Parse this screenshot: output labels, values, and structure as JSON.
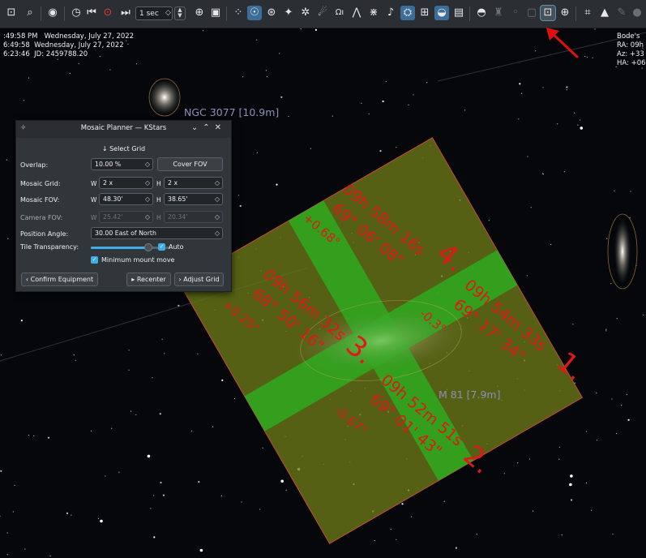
{
  "toolbar": {
    "time_step": "1 sec",
    "icons": [
      "zoom-fit-icon",
      "search-icon",
      "globe-icon",
      "clock-icon",
      "step-backward-icon",
      "pause-clock-icon",
      "step-forward-icon",
      "rate-select",
      "spin-icon",
      "equatorial-icon",
      "image-overlay-icon",
      "stars-icon",
      "deep-sky-icon",
      "galaxy-icon",
      "star-icon",
      "nebula-icon",
      "comet-icon",
      "constellation-names-icon",
      "constellation-lines-icon",
      "constellation-art-icon",
      "milky-way-icon",
      "grid-icon",
      "boundaries-icon",
      "horizon-icon",
      "satellite-icon",
      "supernova-icon",
      "hips-icon",
      "telescope-icon",
      "flag-icon",
      "eyepiece-icon",
      "mosaic-icon",
      "crosshair-icon",
      "fov-icon",
      "lock-icon",
      "pencil-icon",
      "more-icon"
    ]
  },
  "info_left": {
    "line1": ":49:58 PM   Wednesday, July 27, 2022",
    "line2": "6:49:58  Wednesday, July 27, 2022",
    "line3": "6:23:46  JD: 2459788.20"
  },
  "info_right": {
    "line1": "Bode's",
    "line2": "RA: 09h",
    "line3": "Az: +33",
    "line4": "HA: +06"
  },
  "sky_objects": {
    "ngc3077": "NGC 3077 [10.9m]",
    "m81": "M 81 [7.9m]"
  },
  "colors": {
    "tile_fill": "#6b7a17",
    "tile_border": "#c84a3a",
    "overlap": "#2faa1e",
    "tile_text": "#e01818",
    "accent": "#3daee9"
  },
  "tiles": [
    {
      "number": "4.",
      "ra": "09h 58m 16s",
      "dec": "69° 06' 08\"",
      "angle": "+0.68°"
    },
    {
      "number": "3.",
      "ra": "09h 56m 32s",
      "dec": "68° 50' 16\"",
      "angle": "+0.25°"
    },
    {
      "number": "1.",
      "ra": "09h 54m 33s",
      "dec": "69° 17' 34\"",
      "angle": "-0.3°"
    },
    {
      "number": "2.",
      "ra": "09h 52m 51s",
      "dec": "69° 01' 43\"",
      "angle": "-0.67°"
    }
  ],
  "dialog": {
    "title": "Mosaic Planner — KStars",
    "select_grid": "↓ Select Grid",
    "overlap_label": "Overlap:",
    "overlap_value": "10.00 %",
    "cover_fov": "Cover FOV",
    "grid_label": "Mosaic Grid:",
    "grid_w": "2 x",
    "grid_h": "2 x",
    "fov_label": "Mosaic FOV:",
    "fov_w": "48.30'",
    "fov_h": "38.65'",
    "camera_label": "Camera FOV:",
    "camera_w": "25.42'",
    "camera_h": "20.34'",
    "w": "W",
    "h": "H",
    "pa_label": "Position Angle:",
    "pa_value": "30.00 East of North",
    "transparency_label": "Tile Transparency:",
    "transparency_level": 0.72,
    "auto_label": "Auto",
    "auto_checked": true,
    "min_mount_label": "Minimum mount move",
    "min_mount_checked": true,
    "confirm_equipment": "Confirm Equipment",
    "recenter": "Recenter",
    "adjust_grid": "Adjust Grid"
  }
}
